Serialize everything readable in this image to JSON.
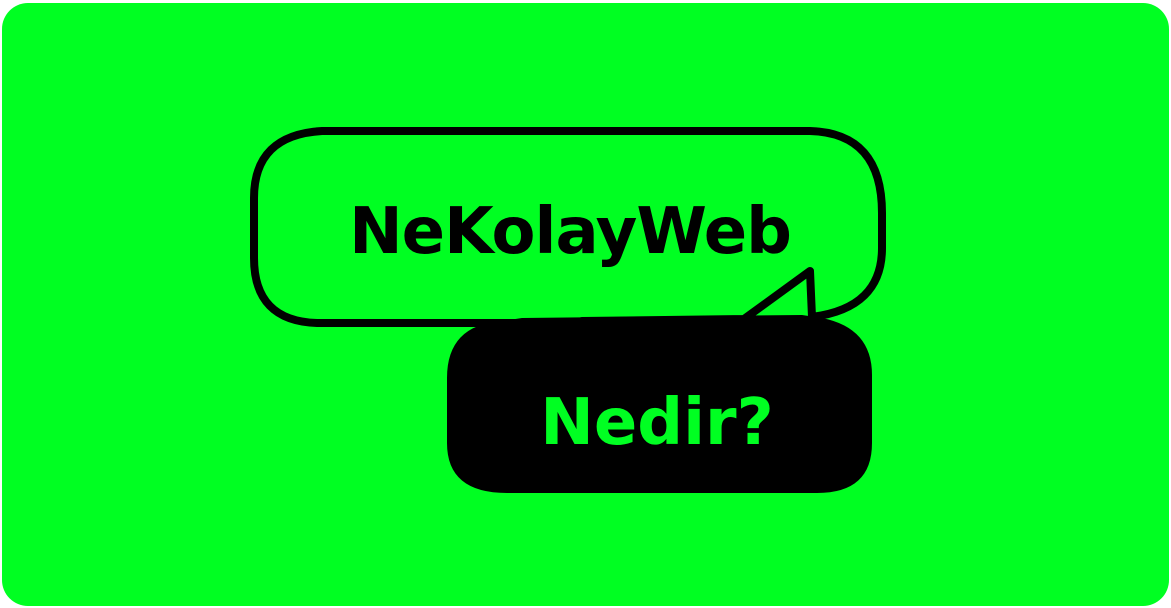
{
  "colors": {
    "background": "#00ff22",
    "ink": "#000000",
    "accent_text": "#00ff22"
  },
  "bubbles": {
    "primary_text": "NeKolayWeb",
    "secondary_text": "Nedir?"
  }
}
